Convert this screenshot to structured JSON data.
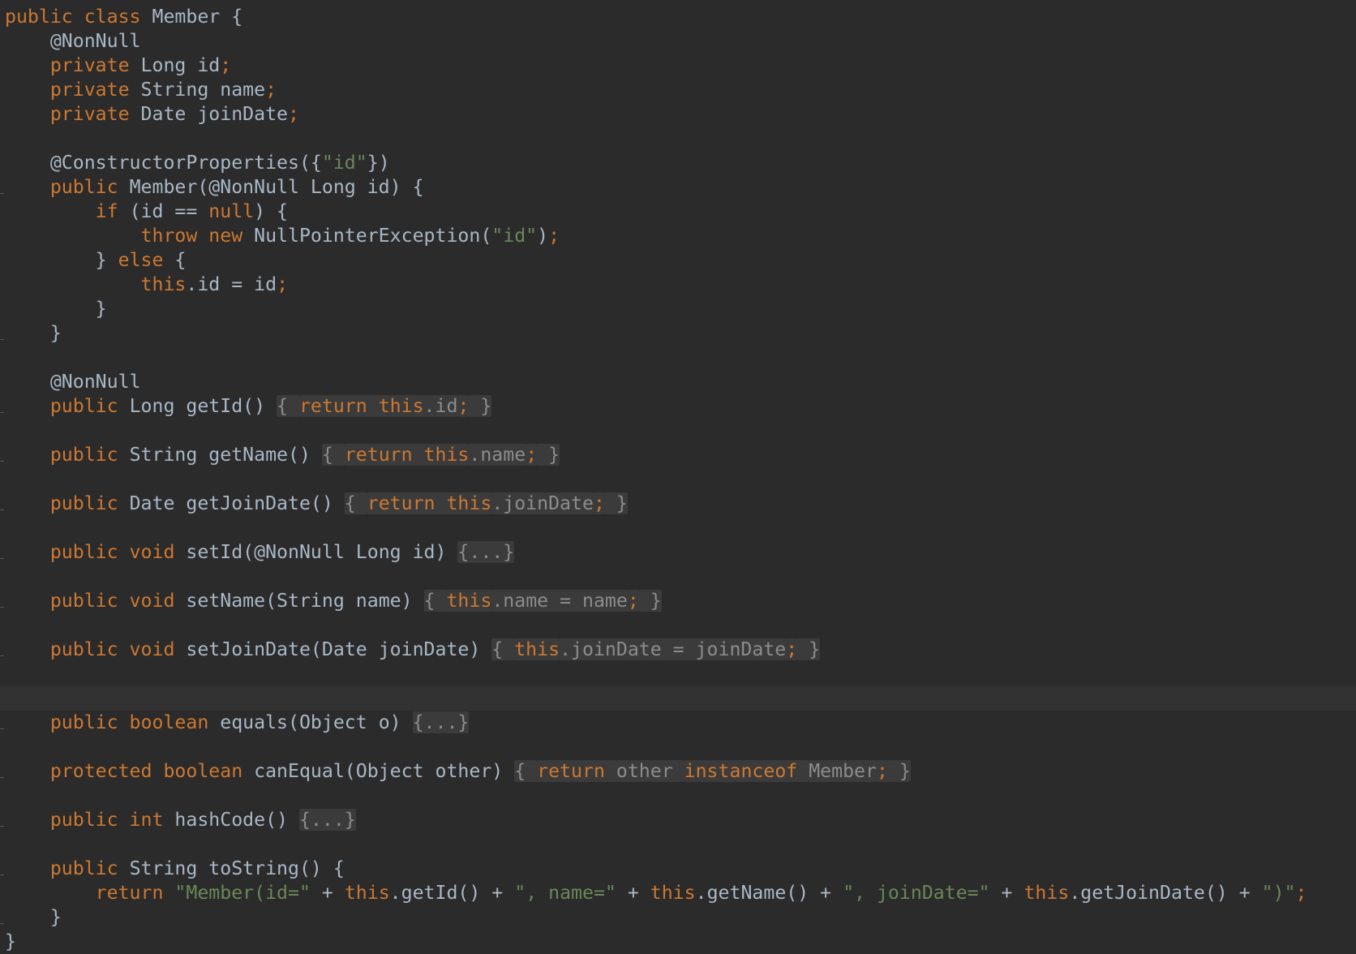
{
  "editor": {
    "language": "Java",
    "theme": "Darcula",
    "current_line": 28,
    "lines": [
      [
        [
          "kw",
          "public class "
        ],
        [
          "t",
          "Member {"
        ]
      ],
      [
        [
          "t",
          "    @NonNull"
        ]
      ],
      [
        [
          "kw",
          "    private "
        ],
        [
          "t",
          "Long id"
        ],
        [
          "kw",
          ";"
        ]
      ],
      [
        [
          "kw",
          "    private "
        ],
        [
          "t",
          "String name"
        ],
        [
          "kw",
          ";"
        ]
      ],
      [
        [
          "kw",
          "    private "
        ],
        [
          "t",
          "Date joinDate"
        ],
        [
          "kw",
          ";"
        ]
      ],
      [],
      [
        [
          "t",
          "    @ConstructorProperties({"
        ],
        [
          "str",
          "\"id\""
        ],
        [
          "t",
          "})"
        ]
      ],
      [
        [
          "kw",
          "    public "
        ],
        [
          "t",
          "Member(@NonNull Long id) {"
        ]
      ],
      [
        [
          "kw",
          "        if "
        ],
        [
          "t",
          "(id == "
        ],
        [
          "kw",
          "null"
        ],
        [
          "t",
          ") {"
        ]
      ],
      [
        [
          "kw",
          "            throw new "
        ],
        [
          "t",
          "NullPointerException("
        ],
        [
          "str",
          "\"id\""
        ],
        [
          "t",
          ")"
        ],
        [
          "kw",
          ";"
        ]
      ],
      [
        [
          "t",
          "        } "
        ],
        [
          "kw",
          "else "
        ],
        [
          "t",
          "{"
        ]
      ],
      [
        [
          "kw",
          "            this"
        ],
        [
          "t",
          ".id = id"
        ],
        [
          "kw",
          ";"
        ]
      ],
      [
        [
          "t",
          "        }"
        ]
      ],
      [
        [
          "t",
          "    }"
        ]
      ],
      [],
      [
        [
          "t",
          "    @NonNull"
        ]
      ],
      [
        [
          "kw",
          "    public "
        ],
        [
          "t",
          "Long getId() "
        ],
        [
          "fold",
          "{ "
        ],
        [
          "foldkw",
          "return this"
        ],
        [
          "fold",
          ".id"
        ],
        [
          "foldkw",
          ";"
        ],
        [
          "fold",
          " }"
        ]
      ],
      [],
      [
        [
          "kw",
          "    public "
        ],
        [
          "t",
          "String getName() "
        ],
        [
          "fold",
          "{ "
        ],
        [
          "foldkw",
          "return this"
        ],
        [
          "fold",
          ".name"
        ],
        [
          "foldkw",
          ";"
        ],
        [
          "fold",
          " }"
        ]
      ],
      [],
      [
        [
          "kw",
          "    public "
        ],
        [
          "t",
          "Date getJoinDate() "
        ],
        [
          "fold",
          "{ "
        ],
        [
          "foldkw",
          "return this"
        ],
        [
          "fold",
          ".joinDate"
        ],
        [
          "foldkw",
          ";"
        ],
        [
          "fold",
          " }"
        ]
      ],
      [],
      [
        [
          "kw",
          "    public void "
        ],
        [
          "t",
          "setId(@NonNull Long id) "
        ],
        [
          "fold",
          "{...}"
        ]
      ],
      [],
      [
        [
          "kw",
          "    public void "
        ],
        [
          "t",
          "setName(String name) "
        ],
        [
          "fold",
          "{ "
        ],
        [
          "foldkw",
          "this"
        ],
        [
          "fold",
          ".name = name"
        ],
        [
          "foldkw",
          ";"
        ],
        [
          "fold",
          " }"
        ]
      ],
      [],
      [
        [
          "kw",
          "    public void "
        ],
        [
          "t",
          "setJoinDate(Date joinDate) "
        ],
        [
          "fold",
          "{ "
        ],
        [
          "foldkw",
          "this"
        ],
        [
          "fold",
          ".joinDate = joinDate"
        ],
        [
          "foldkw",
          ";"
        ],
        [
          "fold",
          " }"
        ]
      ],
      [],
      [],
      [
        [
          "kw",
          "    public boolean "
        ],
        [
          "t",
          "equals(Object o) "
        ],
        [
          "fold",
          "{...}"
        ]
      ],
      [],
      [
        [
          "kw",
          "    protected boolean "
        ],
        [
          "t",
          "canEqual(Object other) "
        ],
        [
          "fold",
          "{ "
        ],
        [
          "foldkw",
          "return "
        ],
        [
          "fold",
          "other "
        ],
        [
          "foldkw",
          "instanceof "
        ],
        [
          "fold",
          "Member"
        ],
        [
          "foldkw",
          ";"
        ],
        [
          "fold",
          " }"
        ]
      ],
      [],
      [
        [
          "kw",
          "    public int "
        ],
        [
          "t",
          "hashCode() "
        ],
        [
          "fold",
          "{...}"
        ]
      ],
      [],
      [
        [
          "kw",
          "    public "
        ],
        [
          "t",
          "String toString() {"
        ]
      ],
      [
        [
          "kw",
          "        return "
        ],
        [
          "str",
          "\"Member(id=\""
        ],
        [
          "t",
          " + "
        ],
        [
          "kw",
          "this"
        ],
        [
          "t",
          ".getId() + "
        ],
        [
          "str",
          "\", name=\""
        ],
        [
          "t",
          " + "
        ],
        [
          "kw",
          "this"
        ],
        [
          "t",
          ".getName() + "
        ],
        [
          "str",
          "\", joinDate=\""
        ],
        [
          "t",
          " + "
        ],
        [
          "kw",
          "this"
        ],
        [
          "t",
          ".getJoinDate() + "
        ],
        [
          "str",
          "\")\""
        ],
        [
          "kw",
          ";"
        ]
      ],
      [
        [
          "t",
          "    }"
        ]
      ],
      [
        [
          "t",
          "}"
        ]
      ]
    ]
  },
  "colors": {
    "background": "#2b2b2b",
    "keyword": "#cc7832",
    "string": "#6a8759",
    "text": "#a9b7c6",
    "fold_background": "#3b3b3b"
  }
}
